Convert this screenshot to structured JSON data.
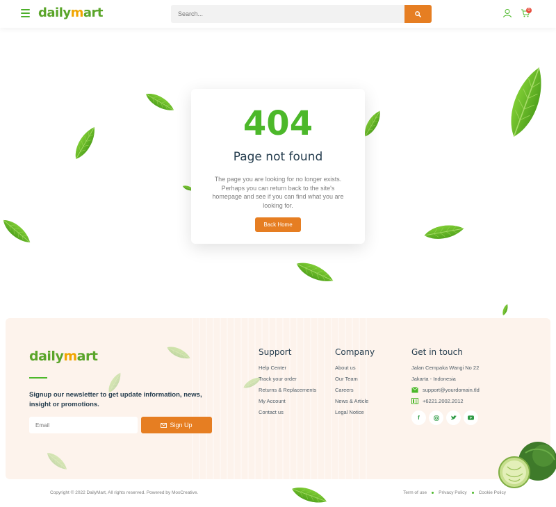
{
  "header": {
    "logo": {
      "part1": "daily",
      "part2": "m",
      "part3": "art"
    },
    "search": {
      "placeholder": "Search..."
    },
    "icons": {
      "menu": "hamburger-icon",
      "search": "search-icon",
      "account": "user-icon",
      "cart": "cart-icon"
    },
    "cart_count": "0"
  },
  "error": {
    "code": "404",
    "title": "Page not found",
    "message": "The page you are looking for no longer exists. Perhaps you can return back to the site's homepage and see if you can find what you are looking for.",
    "button": "Back Home"
  },
  "footer": {
    "logo": {
      "part1": "daily",
      "part2": "m",
      "part3": "art"
    },
    "newsletter_text": "Signup our newsletter to get update information, news, insight or promotions.",
    "email_placeholder": "Email",
    "signup_button": "Sign Up",
    "support": {
      "title": "Support",
      "links": [
        "Help Center",
        "Track your order",
        "Returns & Replacements",
        "My Account",
        "Contact us"
      ]
    },
    "company": {
      "title": "Company",
      "links": [
        "About us",
        "Our Team",
        "Careers",
        "News & Article",
        "Legal Notice"
      ]
    },
    "contact": {
      "title": "Get in touch",
      "address1": "Jalan Cempaka Wangi No 22",
      "address2": "Jakarta - Indonesia",
      "email": "support@yourdomain.tld",
      "phone": "+6221.2002.2012"
    },
    "socials": [
      "facebook-icon",
      "instagram-icon",
      "twitter-icon",
      "youtube-icon"
    ]
  },
  "bottom": {
    "copyright": "Copyright © 2022 DailyMart, All rights reserved. Powered by MoxCreative.",
    "links": [
      "Term of use",
      "Privacy Policy",
      "Cookie Policy"
    ]
  },
  "colors": {
    "brand_green": "#4cb82a",
    "accent_orange": "#e67e22",
    "footer_bg": "#fdf3ec"
  }
}
